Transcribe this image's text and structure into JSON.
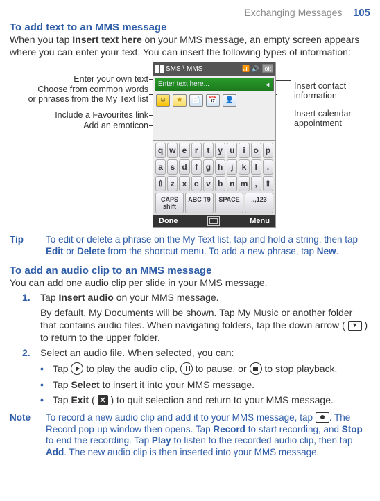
{
  "header": {
    "section": "Exchanging Messages",
    "page": "105"
  },
  "s1": {
    "title": "To add text to an MMS message",
    "intro_a": "When you tap ",
    "intro_b": "Insert text here",
    "intro_c": " on your MMS message, an empty screen appears where you can enter your text. You can insert the following types of information:"
  },
  "callouts": {
    "c1": "Enter your own text",
    "c2a": "Choose from common words",
    "c2b": "or phrases from the My Text list",
    "c3": "Include a Favourites link",
    "c4": "Add an emoticon",
    "r1a": "Insert contact",
    "r1b": "information",
    "r2a": "Insert calendar",
    "r2b": "appointment"
  },
  "phone": {
    "title": "SMS \\ MMS",
    "ok": "ok",
    "placeholder": "Enter text here...",
    "soft_left": "Done",
    "soft_right": "Menu",
    "rows": {
      "r1": [
        "q",
        "w",
        "e",
        "r",
        "t",
        "y",
        "u",
        "i",
        "o",
        "p"
      ],
      "r2": [
        "a",
        "s",
        "d",
        "f",
        "g",
        "h",
        "j",
        "k",
        "l",
        "."
      ],
      "r3": [
        "",
        "z",
        "x",
        "c",
        "v",
        "b",
        "n",
        "m",
        ",",
        ""
      ],
      "r4": [
        "CAPS shift",
        "ABC T9",
        "SPACE",
        "..,123"
      ]
    }
  },
  "tip": {
    "label": "Tip",
    "text_a": "To edit or delete a phrase on the My Text list, tap and hold a string, then tap ",
    "edit": "Edit",
    "text_b": " or ",
    "delete": "Delete",
    "text_c": " from the shortcut menu. To add a new phrase, tap ",
    "new": "New",
    "period": "."
  },
  "s2": {
    "title": "To add an audio clip to an MMS message",
    "intro": "You can add one audio clip per slide in your MMS message.",
    "step1_a": "Tap ",
    "step1_b": "Insert audio",
    "step1_c": " on your MMS message.",
    "step1_block": "By default, My Documents will be shown. Tap My Music or another folder that contains audio files. When navigating folders, tap the down arrow (",
    "step1_block_end": " ) to return to the upper folder.",
    "step2": "Select an audio file. When selected, you can:",
    "b1_a": "Tap ",
    "b1_b": " to play the audio clip, ",
    "b1_c": " to pause, or ",
    "b1_d": " to stop playback.",
    "b2_a": "Tap ",
    "b2_b": "Select",
    "b2_c": " to insert it into your MMS message.",
    "b3_a": "Tap ",
    "b3_b": "Exit",
    "b3_c": " ( ",
    "b3_d": " ) to quit selection and return to your MMS message."
  },
  "note": {
    "label": "Note",
    "a": "To record a new audio clip and add it to your MMS message, tap ",
    "b": ". The Record pop-up window then opens. Tap ",
    "rec": "Record",
    "c": " to start recording, and ",
    "stop": "Stop",
    "d": " to end the recording. Tap ",
    "play": "Play",
    "e": " to listen to the recorded audio clip, then tap ",
    "add": "Add",
    "f": ". The new audio clip is then inserted into your MMS message."
  }
}
